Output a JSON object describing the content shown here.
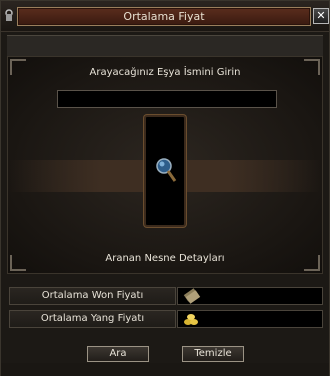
{
  "window": {
    "title": "Ortalama Fiyat",
    "close_label": "✕"
  },
  "search": {
    "prompt": "Arayacağınız Eşya İsmini Girin",
    "value": ""
  },
  "details": {
    "label": "Aranan Nesne Detayları"
  },
  "prices": [
    {
      "label": "Ortalama Won Fiyatı",
      "value": "",
      "icon": "won-note-icon"
    },
    {
      "label": "Ortalama Yang Fiyatı",
      "value": "",
      "icon": "gold-coins-icon"
    }
  ],
  "buttons": {
    "search": "Ara",
    "clear": "Temizle"
  }
}
